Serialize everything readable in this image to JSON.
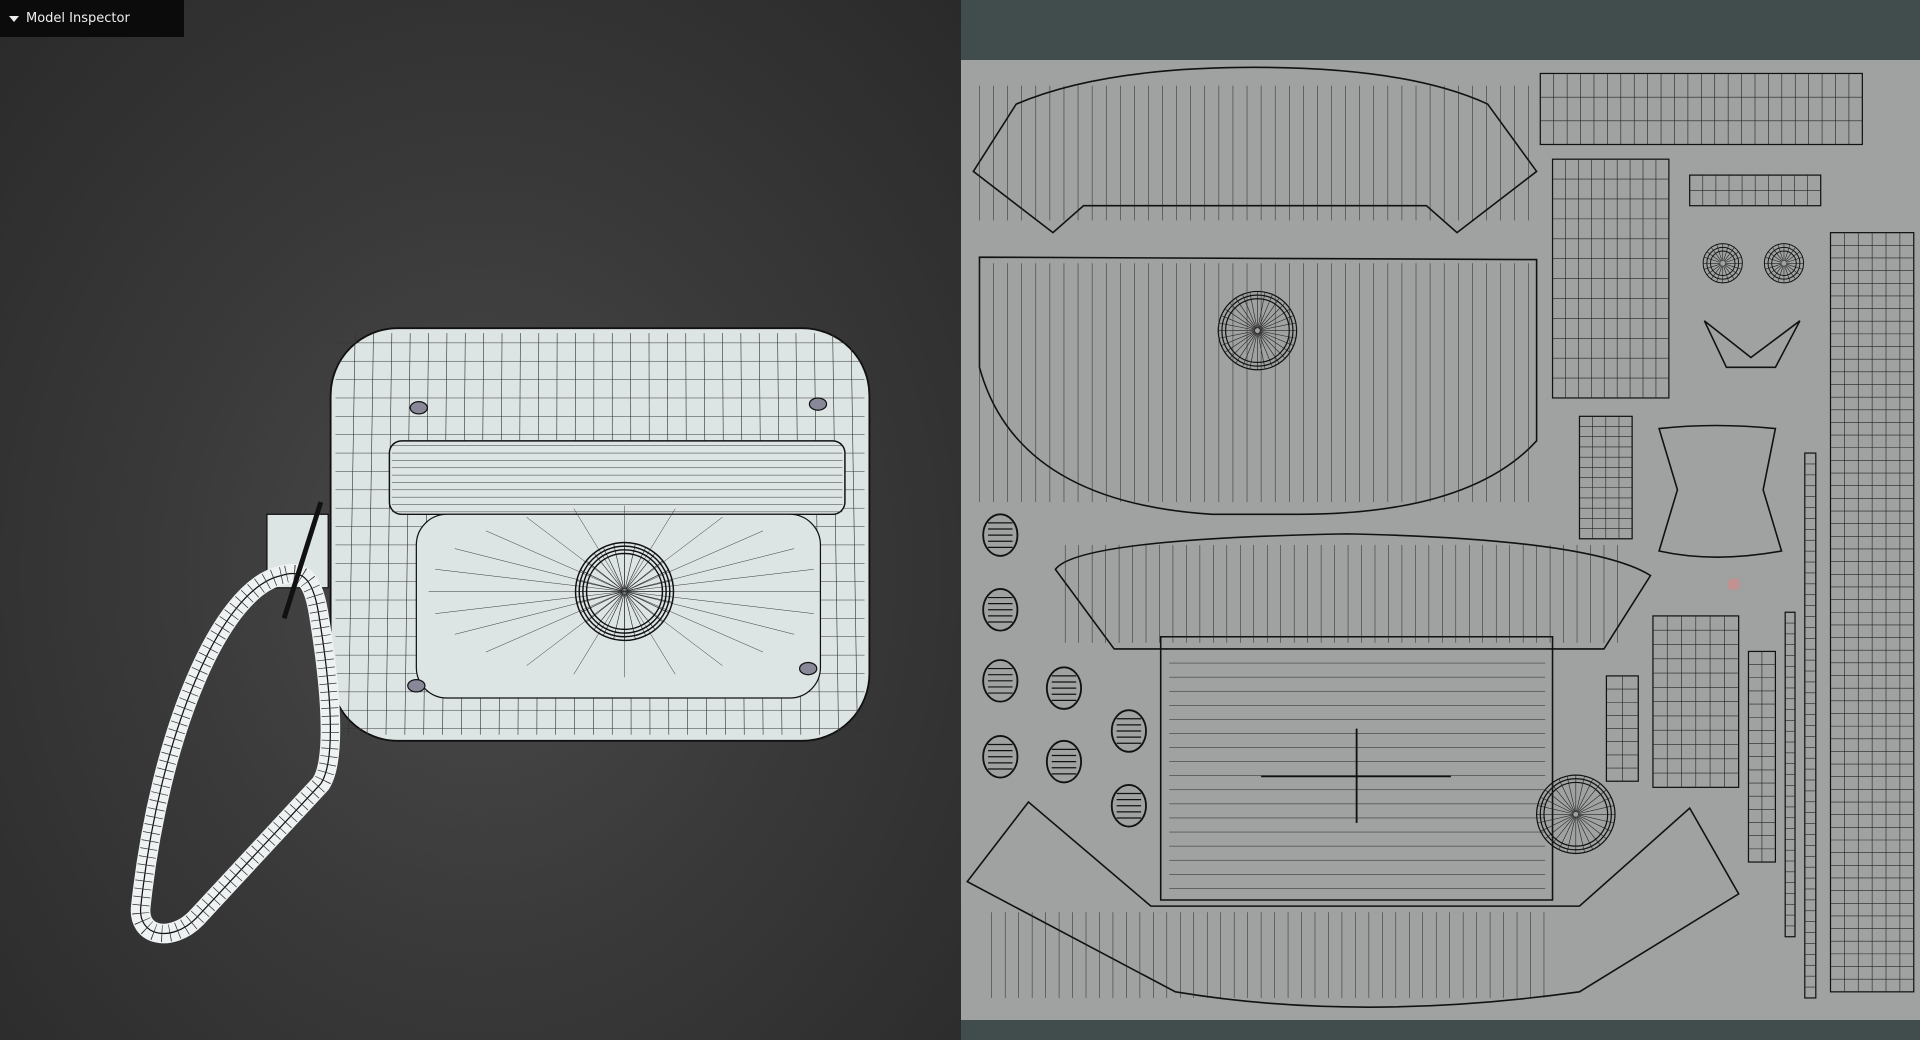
{
  "inspector": {
    "label": "Model Inspector",
    "icon": "triangle-down-icon",
    "expanded": true
  },
  "colors": {
    "viewport_bg": "#3a3a3a",
    "uv_panel_bg": "#414c4c",
    "uv_sheet": "#a0a2a1",
    "mesh_fill": "#dde4e4",
    "wire": "#111111"
  }
}
